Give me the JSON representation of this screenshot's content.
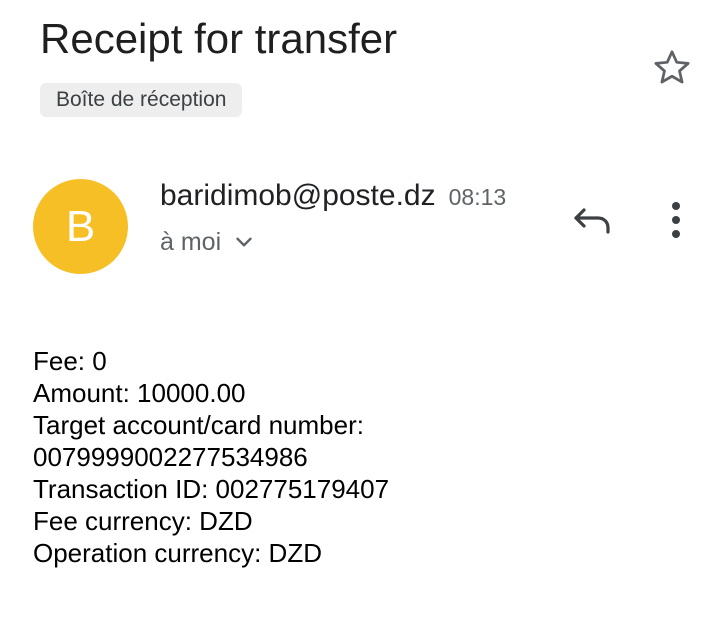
{
  "email": {
    "subject": "Receipt for transfer",
    "label": "Boîte de réception",
    "sender": {
      "avatar_letter": "B",
      "address": "baridimob@poste.dz",
      "time": "08:13",
      "recipient": "à moi"
    },
    "body_lines": [
      "Fee: 0",
      "Amount: 10000.00",
      "Target account/card number:",
      "0079999002277534986",
      "Transaction ID: 002775179407",
      "Fee currency: DZD",
      "Operation currency: DZD"
    ]
  },
  "icons": {
    "star": "star-outline-icon",
    "reply": "reply-icon",
    "more": "more-vert-icon",
    "expand": "chevron-down-icon"
  },
  "colors": {
    "avatar_bg": "#f6bf26",
    "chip_bg": "#eeeeee",
    "secondary_text": "#5f6368"
  }
}
